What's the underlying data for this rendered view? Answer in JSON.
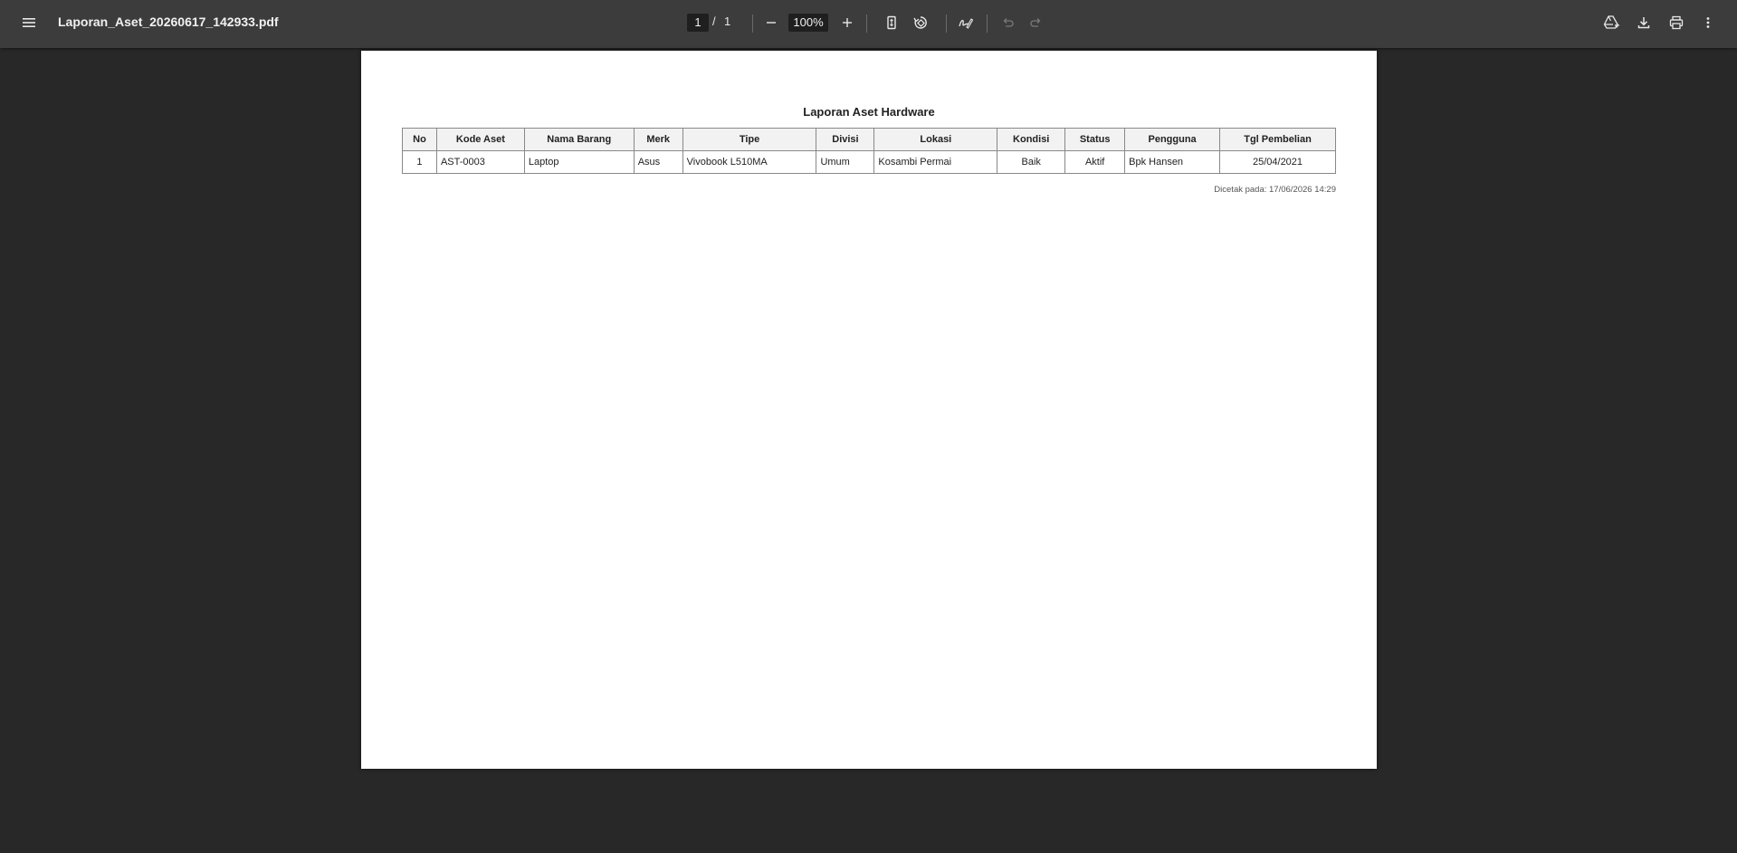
{
  "toolbar": {
    "file_name": "Laporan_Aset_20260617_142933.pdf",
    "current_page": "1",
    "page_separator": "/",
    "total_pages": "1",
    "zoom": "100%"
  },
  "icons": {
    "menu": "menu-icon",
    "zoom_out": "minus-icon",
    "zoom_in": "plus-icon",
    "fit_page": "fit-page-icon",
    "rotate": "rotate-icon",
    "annotate": "draw-icon",
    "undo": "undo-icon",
    "redo": "redo-icon",
    "drive": "add-to-drive-icon",
    "download": "download-icon",
    "print": "print-icon",
    "more": "more-vert-icon"
  },
  "report": {
    "title": "Laporan Aset Hardware",
    "columns": [
      "No",
      "Kode Aset",
      "Nama Barang",
      "Merk",
      "Tipe",
      "Divisi",
      "Lokasi",
      "Kondisi",
      "Status",
      "Pengguna",
      "Tgl Pembelian"
    ],
    "rows": [
      [
        "1",
        "AST-0003",
        "Laptop",
        "Asus",
        "Vivobook L510MA",
        "Umum",
        "Kosambi Permai",
        "Baik",
        "Aktif",
        "Bpk Hansen",
        "25/04/2021"
      ]
    ],
    "printed_at": "Dicetak pada: 17/06/2026 14:29"
  },
  "colors": {
    "toolbar_bg": "#3c3c3c",
    "viewer_bg": "#282828",
    "header_bg": "#f2f2f2"
  }
}
